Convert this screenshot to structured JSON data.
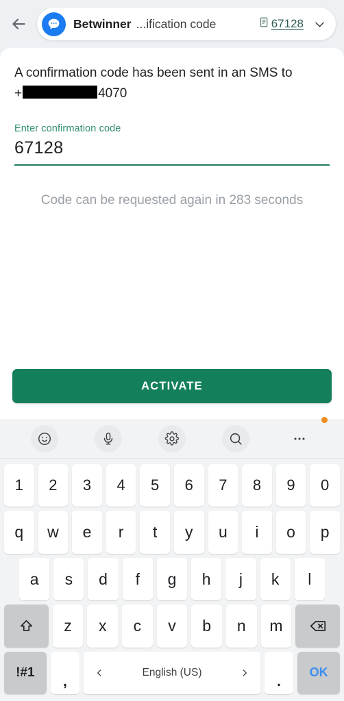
{
  "topbar": {
    "back_icon": "back-arrow-icon",
    "app_icon": "chat-bubble-icon",
    "app_name": "Betwinner",
    "app_subtitle": "...ification code",
    "copy_icon": "document-copy-icon",
    "code_chip": "67128",
    "chevron_icon": "chevron-down-icon"
  },
  "content": {
    "info_prefix": "A confirmation code has been sent in an SMS to",
    "phone_plus": "+",
    "phone_suffix": "4070",
    "field_label": "Enter confirmation code",
    "field_value": "67128",
    "field_placeholder": "Enter confirmation code",
    "resend_text": "Code can be requested again in 283 seconds",
    "activate_label": "ACTIVATE",
    "accent_green": "#14805b",
    "label_green": "#2e8b6d",
    "muted_gray": "#9aa0a6"
  },
  "keyboard": {
    "toolbar": [
      {
        "name": "emoji-icon",
        "label": "emoji"
      },
      {
        "name": "microphone-icon",
        "label": "microphone"
      },
      {
        "name": "gear-icon",
        "label": "settings"
      },
      {
        "name": "search-icon",
        "label": "search"
      },
      {
        "name": "more-options-icon",
        "label": "more",
        "badge": true
      }
    ],
    "badge_color": "#f08c1e",
    "row_numbers": [
      "1",
      "2",
      "3",
      "4",
      "5",
      "6",
      "7",
      "8",
      "9",
      "0"
    ],
    "row_top": [
      "q",
      "w",
      "e",
      "r",
      "t",
      "y",
      "u",
      "i",
      "o",
      "p"
    ],
    "row_home": [
      "a",
      "s",
      "d",
      "f",
      "g",
      "h",
      "j",
      "k",
      "l"
    ],
    "row_bottom": [
      "z",
      "x",
      "c",
      "v",
      "b",
      "n",
      "m"
    ],
    "shift_icon": "shift-arrow-icon",
    "backspace_icon": "backspace-icon",
    "symbols_key": "!#1",
    "comma_key": ",",
    "space_label": "English (US)",
    "space_prev_icon": "chevron-left-icon",
    "space_next_icon": "chevron-right-icon",
    "period_key": ".",
    "ok_key": "OK"
  }
}
